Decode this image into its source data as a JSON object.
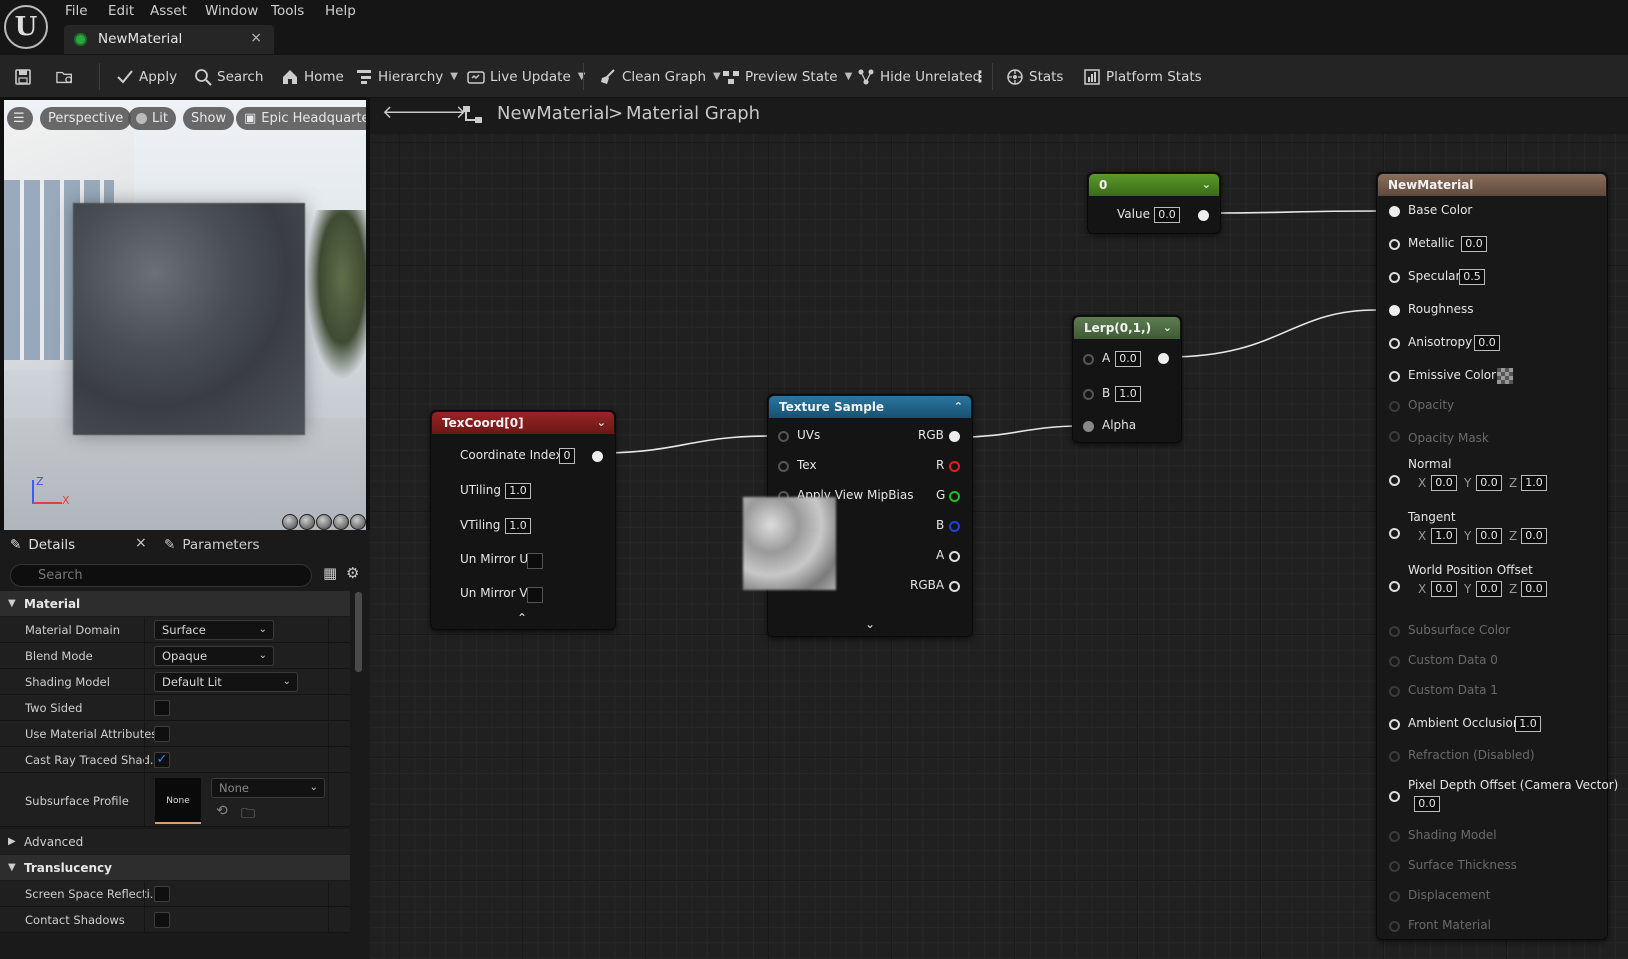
{
  "menu": [
    "File",
    "Edit",
    "Asset",
    "Window",
    "Tools",
    "Help"
  ],
  "doc_tab": {
    "title": "NewMaterial",
    "close": "×"
  },
  "toolbar": {
    "apply": "Apply",
    "search": "Search",
    "home": "Home",
    "hierarchy": "Hierarchy",
    "live_update": "Live Update",
    "clean_graph": "Clean Graph",
    "preview_state": "Preview State",
    "hide_unrelated": "Hide Unrelated",
    "stats": "Stats",
    "platform_stats": "Platform Stats"
  },
  "viewport": {
    "perspective": "Perspective",
    "lit": "Lit",
    "show": "Show",
    "level": "Epic Headquarters",
    "axis_z": "Z",
    "axis_x": "X"
  },
  "details": {
    "tab_details": "Details",
    "tab_close": "×",
    "tab_parameters": "Parameters",
    "search_placeholder": "Search",
    "section_material": "Material",
    "material_domain_label": "Material Domain",
    "material_domain": "Surface",
    "blend_mode_label": "Blend Mode",
    "blend_mode": "Opaque",
    "shading_model_label": "Shading Model",
    "shading_model": "Default Lit",
    "two_sided_label": "Two Sided",
    "use_material_attributes_label": "Use Material Attributes",
    "cast_ray_traced_label": "Cast Ray Traced Shad...",
    "cast_ray_traced_checked": true,
    "subsurface_profile_label": "Subsurface Profile",
    "subsurface_thumb": "None",
    "subsurface_value": "None",
    "section_advanced": "Advanced",
    "section_translucency": "Translucency",
    "ssr_label": "Screen Space Reflecti...",
    "contact_shadows_label": "Contact Shadows"
  },
  "graph": {
    "breadcrumb_root": "NewMaterial",
    "breadcrumb_sep": ">",
    "breadcrumb_leaf": "Material Graph"
  },
  "nodes": {
    "constant": {
      "title": "0",
      "value_label": "Value",
      "value": "0.0"
    },
    "lerp": {
      "title": "Lerp(0,1,)",
      "a_label": "A",
      "a": "0.0",
      "b_label": "B",
      "b": "1.0",
      "alpha_label": "Alpha"
    },
    "texcoord": {
      "title": "TexCoord[0]",
      "coord_index_label": "Coordinate Index",
      "coord_index": "0",
      "utiling_label": "UTiling",
      "utiling": "1.0",
      "vtiling_label": "VTiling",
      "vtiling": "1.0",
      "un_mirror_u_label": "Un Mirror U",
      "un_mirror_v_label": "Un Mirror V"
    },
    "texture_sample": {
      "title": "Texture Sample",
      "uvs": "UVs",
      "tex": "Tex",
      "apply_view_mipbias": "Apply View MipBias",
      "rgb": "RGB",
      "r": "R",
      "g": "G",
      "b": "B",
      "a": "A",
      "rgba": "RGBA"
    },
    "result": {
      "title": "NewMaterial",
      "base_color": "Base Color",
      "metallic": "Metallic",
      "metallic_v": "0.0",
      "specular": "Specular",
      "specular_v": "0.5",
      "roughness": "Roughness",
      "anisotropy": "Anisotropy",
      "anisotropy_v": "0.0",
      "emissive": "Emissive Color",
      "opacity": "Opacity",
      "opacity_mask": "Opacity Mask",
      "normal": "Normal",
      "normal_x": "0.0",
      "normal_y": "0.0",
      "normal_z": "1.0",
      "tangent": "Tangent",
      "tangent_x": "1.0",
      "tangent_y": "0.0",
      "tangent_z": "0.0",
      "wpo": "World Position Offset",
      "wpo_x": "0.0",
      "wpo_y": "0.0",
      "wpo_z": "0.0",
      "subsurface_color": "Subsurface Color",
      "custom_data_0": "Custom Data 0",
      "custom_data_1": "Custom Data 1",
      "ambient_occlusion": "Ambient Occlusion",
      "ambient_occlusion_v": "1.0",
      "refraction": "Refraction (Disabled)",
      "pdo": "Pixel Depth Offset (Camera Vector)",
      "pdo_v": "0.0",
      "shading_model": "Shading Model",
      "surface_thickness": "Surface Thickness",
      "displacement": "Displacement",
      "front_material": "Front Material",
      "x": "X",
      "y": "Y",
      "z": "Z"
    }
  },
  "colors": {
    "texcoord_header": "#7a1b1b",
    "texture_header": "#1e5f82",
    "lerp_header": "#4a6a3e",
    "constant_header": "#4d8a22",
    "result_header": "#7a6250",
    "pin_r": "#e02020",
    "pin_g": "#20c020",
    "pin_b": "#2040e0"
  }
}
